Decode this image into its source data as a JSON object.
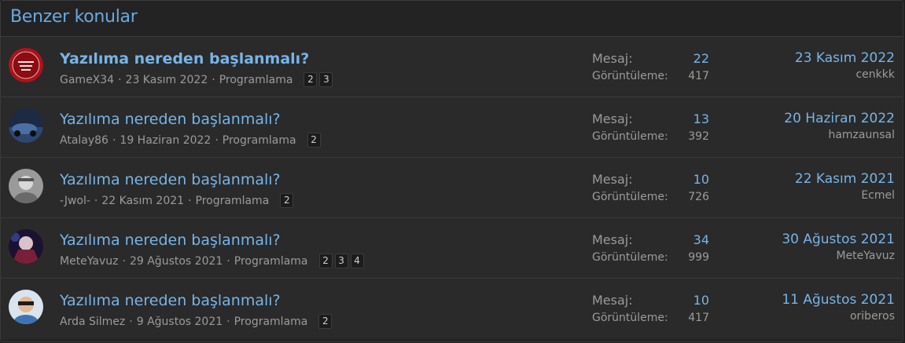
{
  "header": {
    "title": "Benzer konular"
  },
  "labels": {
    "messages": "Mesaj:",
    "views": "Görüntüleme:"
  },
  "threads": [
    {
      "title": "Yazılıma nereden başlanmalı?",
      "author": "GameX34",
      "date": "23 Kasım 2022",
      "forum": "Programlama",
      "pages": [
        "2",
        "3"
      ],
      "messages": "22",
      "views": "417",
      "last_date": "23 Kasım 2022",
      "last_user": "cenkkk",
      "unread": true
    },
    {
      "title": "Yazılıma nereden başlanmalı?",
      "author": "Atalay86",
      "date": "19 Haziran 2022",
      "forum": "Programlama",
      "pages": [
        "2"
      ],
      "messages": "13",
      "views": "392",
      "last_date": "20 Haziran 2022",
      "last_user": "hamzaunsal",
      "unread": false
    },
    {
      "title": "Yazılıma nereden başlanmalı?",
      "author": "-Jwol-",
      "date": "22 Kasım 2021",
      "forum": "Programlama",
      "pages": [
        "2"
      ],
      "messages": "10",
      "views": "726",
      "last_date": "22 Kasım 2021",
      "last_user": "Ecmel",
      "unread": false
    },
    {
      "title": "Yazılıma nereden başlanmalı?",
      "author": "MeteYavuz",
      "date": "29 Ağustos 2021",
      "forum": "Programlama",
      "pages": [
        "2",
        "3",
        "4"
      ],
      "messages": "34",
      "views": "999",
      "last_date": "30 Ağustos 2021",
      "last_user": "MeteYavuz",
      "unread": false
    },
    {
      "title": "Yazılıma nereden başlanmalı?",
      "author": "Arda Silmez",
      "date": "9 Ağustos 2021",
      "forum": "Programlama",
      "pages": [
        "2"
      ],
      "messages": "10",
      "views": "417",
      "last_date": "11 Ağustos 2021",
      "last_user": "oriberos",
      "unread": false
    }
  ],
  "colors": {
    "accent": "#77b4e8",
    "background": "#252525",
    "text_muted": "#9b9b9b"
  }
}
